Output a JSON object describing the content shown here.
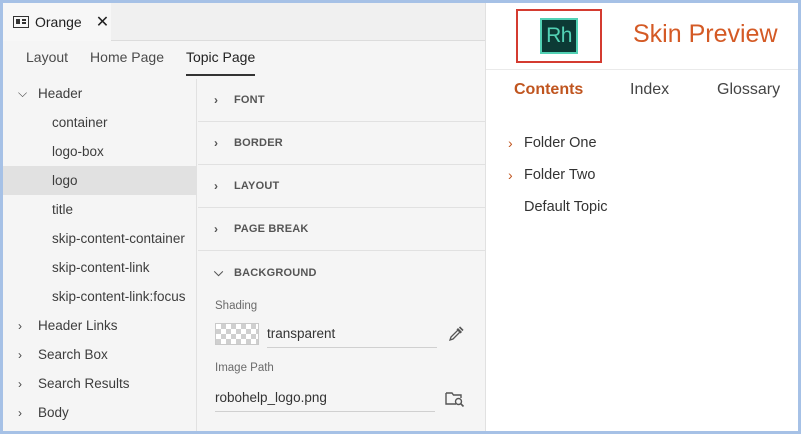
{
  "window": {
    "tab_title": "Orange",
    "close_glyph": "✕"
  },
  "subtabs": [
    "Layout",
    "Home Page",
    "Topic Page"
  ],
  "active_subtab": "Topic Page",
  "tree": {
    "items": [
      {
        "label": "Header",
        "level": 0,
        "expanded": true
      },
      {
        "label": "container",
        "level": 1
      },
      {
        "label": "logo-box",
        "level": 1
      },
      {
        "label": "logo",
        "level": 1,
        "selected": true
      },
      {
        "label": "title",
        "level": 1
      },
      {
        "label": "skip-content-container",
        "level": 1
      },
      {
        "label": "skip-content-link",
        "level": 1
      },
      {
        "label": "skip-content-link:focus",
        "level": 1
      },
      {
        "label": "Header Links",
        "level": 0,
        "expanded": false
      },
      {
        "label": "Search Box",
        "level": 0,
        "expanded": false
      },
      {
        "label": "Search Results",
        "level": 0,
        "expanded": false
      },
      {
        "label": "Body",
        "level": 0,
        "expanded": false
      }
    ]
  },
  "properties": {
    "sections": [
      "FONT",
      "BORDER",
      "LAYOUT",
      "PAGE BREAK",
      "BACKGROUND"
    ],
    "open_section": "BACKGROUND",
    "shading_label": "Shading",
    "shading_value": "transparent",
    "image_path_label": "Image Path",
    "image_path_value": "robohelp_logo.png"
  },
  "preview": {
    "logo_text": "Rh",
    "title": "Skin Preview",
    "tabs": [
      "Contents",
      "Index",
      "Glossary"
    ],
    "active_tab": "Contents",
    "toc": [
      {
        "label": "Folder One",
        "folder": true
      },
      {
        "label": "Folder Two",
        "folder": true
      },
      {
        "label": "Default Topic",
        "folder": false
      }
    ]
  },
  "icons": {
    "doc_tab": "document-window-icon",
    "eyedropper": "eyedropper-icon",
    "browse": "folder-search-icon"
  },
  "colors": {
    "accent_orange": "#d45a25",
    "logo_border_red": "#d43b30",
    "logo_bg": "#0c3a35",
    "logo_teal": "#52d1b4",
    "frame_border": "#a6c1e6"
  }
}
